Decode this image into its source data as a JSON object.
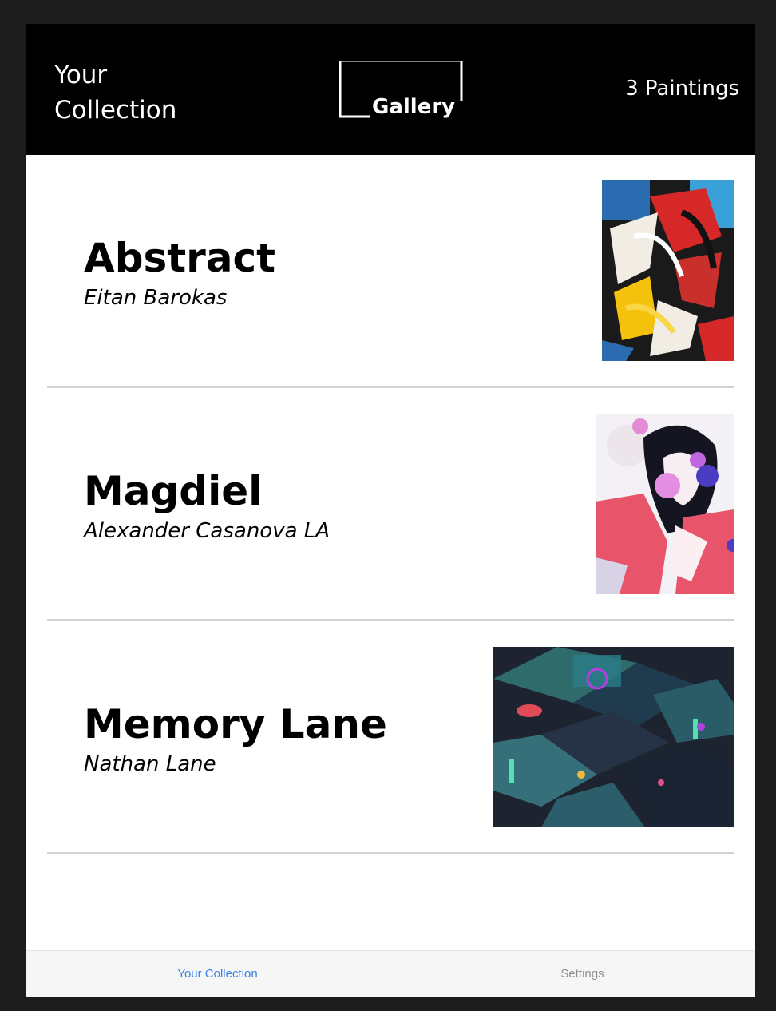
{
  "header": {
    "title": "Your Collection",
    "logo_text": "Gallery",
    "count_label": "3 Paintings"
  },
  "paintings": [
    {
      "title": "Abstract",
      "artist": "Eitan Barokas",
      "thumbnail": "abstract-painting"
    },
    {
      "title": "Magdiel",
      "artist": "Alexander Casanova LA",
      "thumbnail": "portrait-illustration"
    },
    {
      "title": "Memory Lane",
      "artist": "Nathan Lane",
      "thumbnail": "isometric-city-illustration"
    }
  ],
  "tabbar": {
    "tabs": [
      {
        "label": "Your Collection",
        "active": true
      },
      {
        "label": "Settings",
        "active": false
      }
    ]
  },
  "colors": {
    "header_bg": "#000000",
    "accent": "#3b82e8",
    "inactive_tab": "#8e8e8e",
    "divider": "#d3d3d3"
  }
}
